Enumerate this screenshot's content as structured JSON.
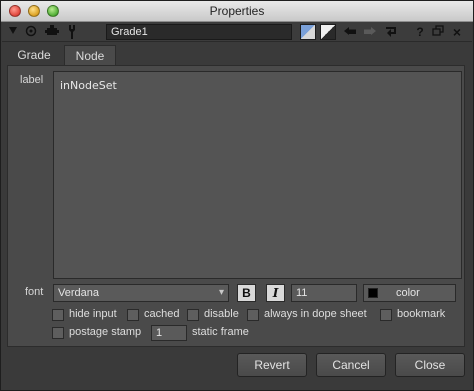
{
  "window": {
    "title": "Properties"
  },
  "toolbar": {
    "node_name": "Grade1",
    "icons": [
      "menu-triangle-icon",
      "target-icon",
      "node-icon",
      "wrench-icon",
      "color-swatch-icon",
      "color-swatch-2-icon",
      "undo-icon",
      "redo-icon",
      "revert-icon",
      "help-icon",
      "float-icon",
      "close-icon"
    ],
    "help_label": "?",
    "close_label": "×"
  },
  "tabs": [
    {
      "label": "Grade"
    },
    {
      "label": "Node"
    }
  ],
  "node_tab": {
    "label_label": "label",
    "label_value": "inNodeSet",
    "font_label": "font",
    "font_value": "Verdana",
    "bold_label": "B",
    "italic_label": "I",
    "size_value": "11",
    "color_label": "color",
    "color_value": "#000000",
    "checkboxes_row1": [
      "hide input",
      "cached",
      "disable",
      "always in dope sheet",
      "bookmark"
    ],
    "postage_stamp_label": "postage stamp",
    "static_frame_value": "1",
    "static_frame_label": "static frame"
  },
  "buttons": {
    "revert": "Revert",
    "cancel": "Cancel",
    "close": "Close"
  }
}
